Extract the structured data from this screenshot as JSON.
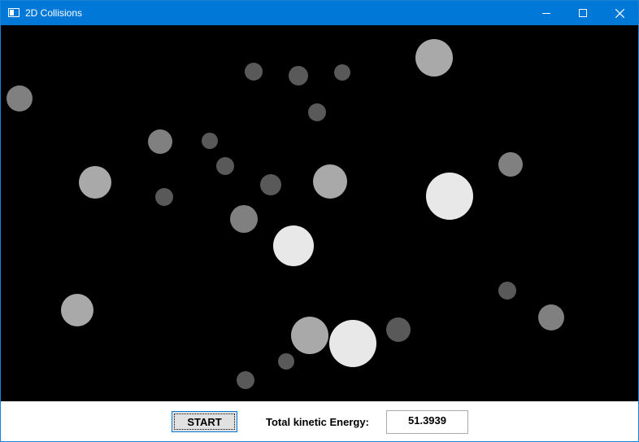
{
  "window": {
    "title": "2D Collisions",
    "title_bar_color": "#0078d7",
    "icon": "window-app-icon",
    "controls": [
      "minimize-icon",
      "maximize-icon",
      "close-icon"
    ]
  },
  "simulation": {
    "background": "#000000",
    "ball_colors": {
      "small": "#595959",
      "medium": "#808080",
      "large": "#a9a9a9",
      "largest": "#e8e8e8"
    }
  },
  "controls": {
    "start_label": "START",
    "energy_label": "Total kinetic Energy:",
    "energy_value": "51.3939"
  }
}
